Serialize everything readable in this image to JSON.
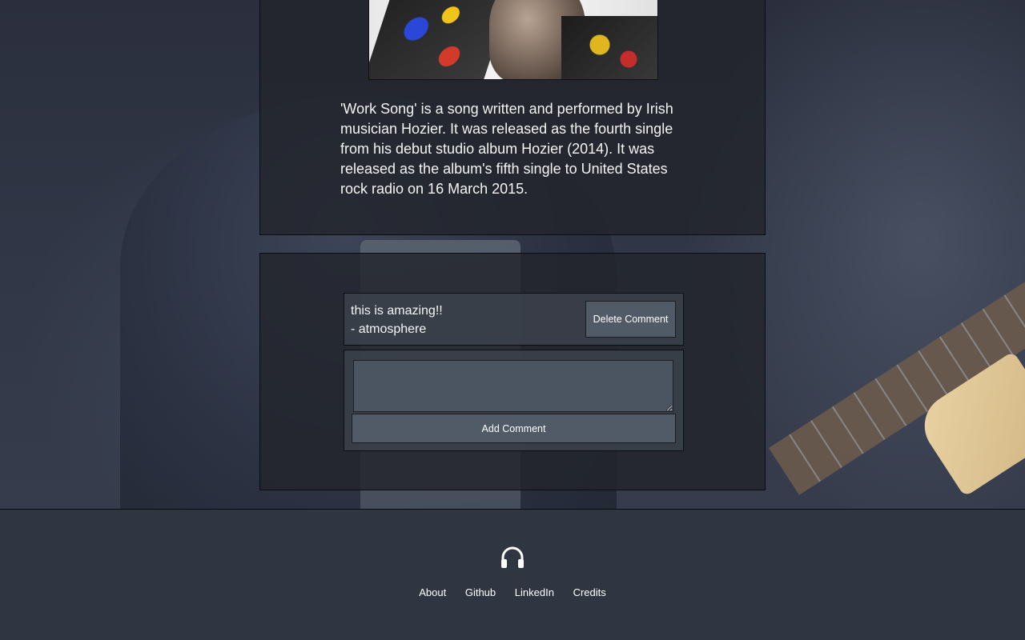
{
  "song": {
    "description": "'Work Song' is a song written and performed by Irish musician Hozier. It was released as the fourth single from his debut studio album Hozier (2014). It was released as the album's fifth single to United States rock radio on 16 March 2015."
  },
  "comments": [
    {
      "text": "this is amazing!!",
      "author": "- atmosphere",
      "delete_label": "Delete Comment"
    }
  ],
  "compose": {
    "value": "",
    "add_label": "Add Comment"
  },
  "footer": {
    "icon": "headphones-icon",
    "links": [
      "About",
      "Github",
      "LinkedIn",
      "Credits"
    ]
  }
}
